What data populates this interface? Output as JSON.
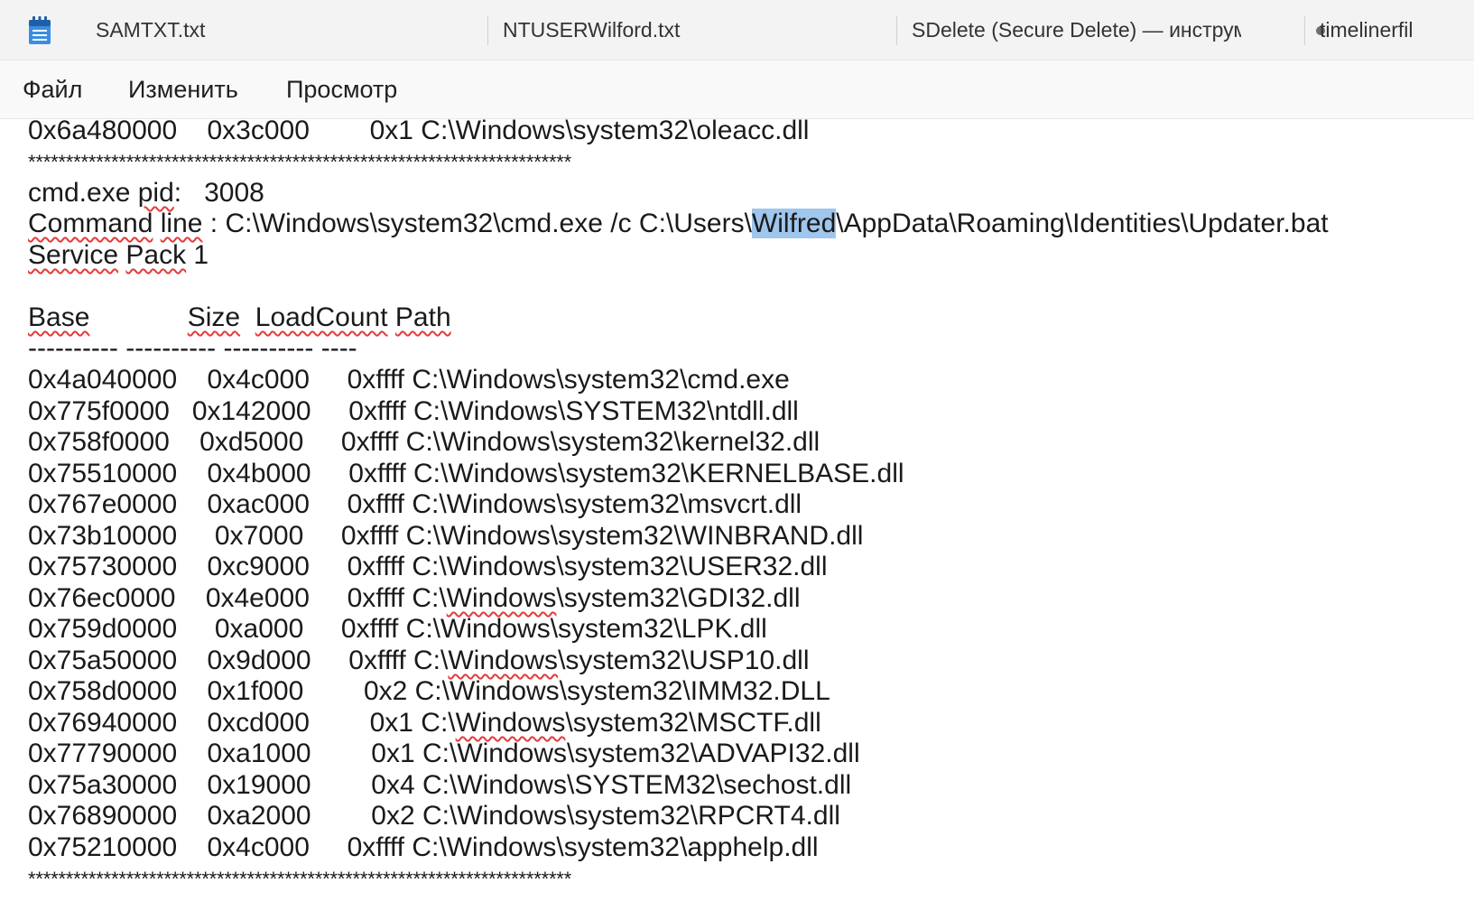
{
  "tabs": [
    {
      "label": "SAMTXT.txt"
    },
    {
      "label": "NTUSERWilford.txt"
    },
    {
      "label": "SDelete (Secure Delete) — инструм"
    },
    {
      "label": "timelinerfil"
    }
  ],
  "menu": [
    "Файл",
    "Изменить",
    "Просмотр"
  ],
  "editor": {
    "l1": "0x6a480000    0x3c000        0x1 C:\\Windows\\system32\\oleacc.dll",
    "l2": "************************************************************************",
    "l4a": "cmd.exe ",
    "l4b": "pid",
    "l4c": ":   3008",
    "l5a": "Command",
    "l5b": " ",
    "l5c": "line",
    "l5d": " : C:\\Windows\\system32\\cmd.exe /c C:\\Users\\",
    "l5e": "Wilfred",
    "l5f": "\\AppData\\Roaming\\Identities\\Updater.bat",
    "l6a": "Service",
    "l6b": " ",
    "l6c": "Pack",
    "l6d": " 1",
    "h_base": "Base",
    "h_gap1": "             ",
    "h_size": "Size",
    "h_gap2": "  ",
    "h_load": "LoadCount",
    "h_gap3": " ",
    "h_path": "Path",
    "dashes": "---------- ---------- ---------- ----",
    "rows": [
      "0x4a040000    0x4c000     0xffff C:\\Windows\\system32\\cmd.exe",
      "0x775f0000   0x142000     0xffff C:\\Windows\\SYSTEM32\\ntdll.dll",
      "0x758f0000    0xd5000     0xffff C:\\Windows\\system32\\kernel32.dll",
      "0x75510000    0x4b000     0xffff C:\\Windows\\system32\\KERNELBASE.dll",
      "0x767e0000    0xac000     0xffff C:\\Windows\\system32\\msvcrt.dll",
      "0x73b10000     0x7000     0xffff C:\\Windows\\system32\\WINBRAND.dll",
      "0x75730000    0xc9000     0xffff C:\\Windows\\system32\\USER32.dll"
    ],
    "r8a": "0x76ec0000    0x4e000     0xffff C:\\",
    "r8b": "Windows",
    "r8c": "\\system32\\GDI32.dll",
    "r9": "0x759d0000     0xa000     0xffff C:\\Windows\\system32\\LPK.dll",
    "r10a": "0x75a50000    0x9d000     0xffff C:\\",
    "r10b": "Windows",
    "r10c": "\\system32\\USP10.dll",
    "r11": "0x758d0000    0x1f000        0x2 C:\\Windows\\system32\\IMM32.DLL",
    "r12a": "0x76940000    0xcd000        0x1 C:\\",
    "r12b": "Windows",
    "r12c": "\\system32\\MSCTF.dll",
    "rows2": [
      "0x77790000    0xa1000        0x1 C:\\Windows\\system32\\ADVAPI32.dll",
      "0x75a30000    0x19000        0x4 C:\\Windows\\SYSTEM32\\sechost.dll",
      "0x76890000    0xa2000        0x2 C:\\Windows\\system32\\RPCRT4.dll",
      "0x75210000    0x4c000     0xffff C:\\Windows\\system32\\apphelp.dll"
    ],
    "l_last": "************************************************************************"
  }
}
